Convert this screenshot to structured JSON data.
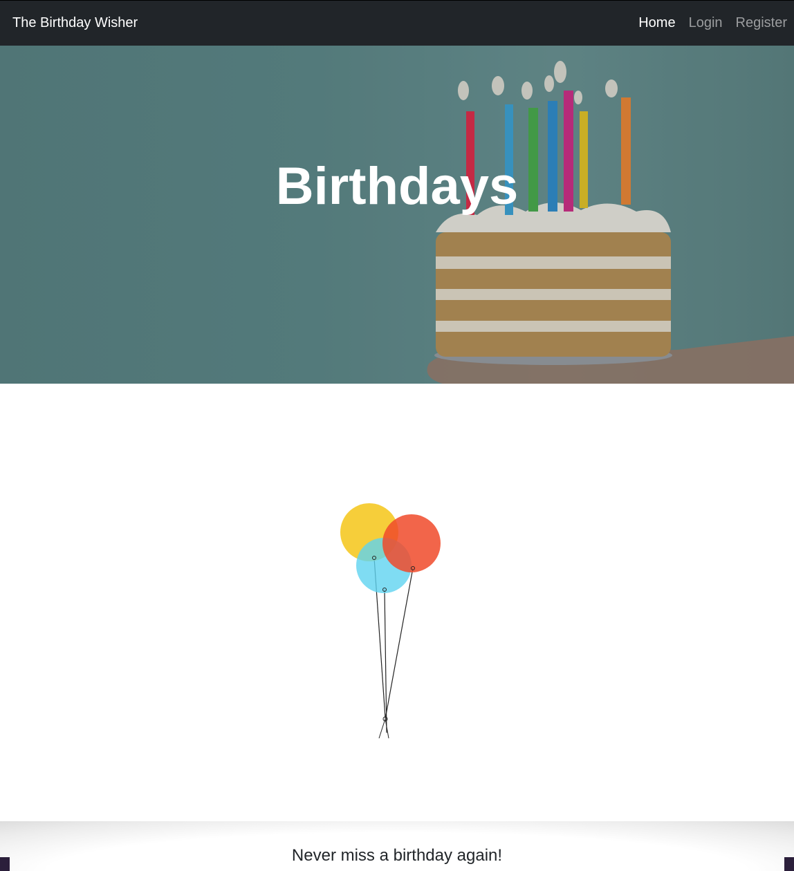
{
  "navbar": {
    "brand": "The Birthday Wisher",
    "links": [
      {
        "label": "Home",
        "active": true
      },
      {
        "label": "Login",
        "active": false
      },
      {
        "label": "Register",
        "active": false
      }
    ]
  },
  "hero": {
    "title": "Birthdays"
  },
  "footer": {
    "tagline": "Never miss a birthday again!"
  },
  "colors": {
    "navbar_bg": "#212529",
    "hero_bg": "#5f8b8c",
    "balloon_yellow": "#f5c518",
    "balloon_red": "#f04a2a",
    "balloon_blue": "#5fd3f0"
  }
}
